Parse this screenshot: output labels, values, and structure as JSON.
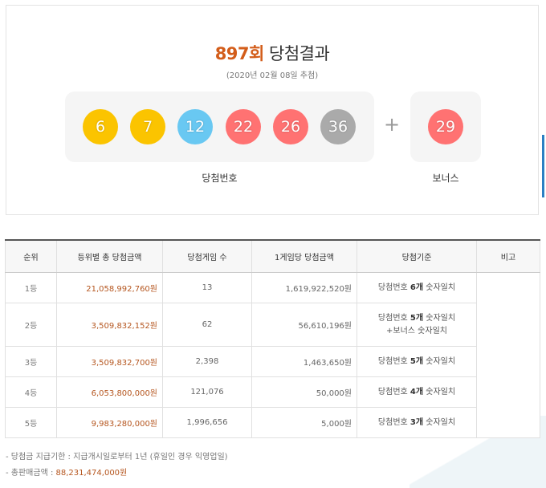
{
  "result": {
    "round": "897회",
    "title_suffix": "당첨결과",
    "draw_date": "(2020년 02월 08일 추첨)",
    "numbers": [
      {
        "value": "6",
        "color": "#fbc400"
      },
      {
        "value": "7",
        "color": "#fbc400"
      },
      {
        "value": "12",
        "color": "#69c8f2"
      },
      {
        "value": "22",
        "color": "#ff7272"
      },
      {
        "value": "26",
        "color": "#ff7272"
      },
      {
        "value": "36",
        "color": "#aaaaaa"
      }
    ],
    "plus": "+",
    "bonus": {
      "value": "29",
      "color": "#ff7272"
    },
    "numbers_label": "당첨번호",
    "bonus_label": "보너스"
  },
  "table": {
    "headers": [
      "순위",
      "등위별 총 당첨금액",
      "당첨게임 수",
      "1게임당 당첨금액",
      "당첨기준",
      "비고"
    ],
    "rows": [
      {
        "rank": "1등",
        "total": "21,058,992,760원",
        "count": "13",
        "per_game": "1,619,922,520원",
        "criteria": {
          "pre": "당첨번호 ",
          "bold": "6개",
          "post": " 숫자일치",
          "line2": ""
        }
      },
      {
        "rank": "2등",
        "total": "3,509,832,152원",
        "count": "62",
        "per_game": "56,610,196원",
        "criteria": {
          "pre": "당첨번호 ",
          "bold": "5개",
          "post": " 숫자일치",
          "line2": "+보너스 숫자일치"
        }
      },
      {
        "rank": "3등",
        "total": "3,509,832,700원",
        "count": "2,398",
        "per_game": "1,463,650원",
        "criteria": {
          "pre": "당첨번호 ",
          "bold": "5개",
          "post": " 숫자일치",
          "line2": ""
        }
      },
      {
        "rank": "4등",
        "total": "6,053,800,000원",
        "count": "121,076",
        "per_game": "50,000원",
        "criteria": {
          "pre": "당첨번호 ",
          "bold": "4개",
          "post": " 숫자일치",
          "line2": ""
        }
      },
      {
        "rank": "5등",
        "total": "9,983,280,000원",
        "count": "1,996,656",
        "per_game": "5,000원",
        "criteria": {
          "pre": "당첨번호 ",
          "bold": "3개",
          "post": " 숫자일치",
          "line2": ""
        }
      }
    ],
    "note_text": ""
  },
  "notes": {
    "payment_deadline": "- 당첨금 지급기한 : 지급개시일로부터 1년 (휴일인 경우 익영업일)",
    "total_sales_label": "- 총판매금액 : ",
    "total_sales_value": "88,231,474,000원"
  },
  "colors": {
    "accent": "#d35d1a",
    "amount": "#b5561f",
    "side_bar": "#2b7fc3"
  }
}
